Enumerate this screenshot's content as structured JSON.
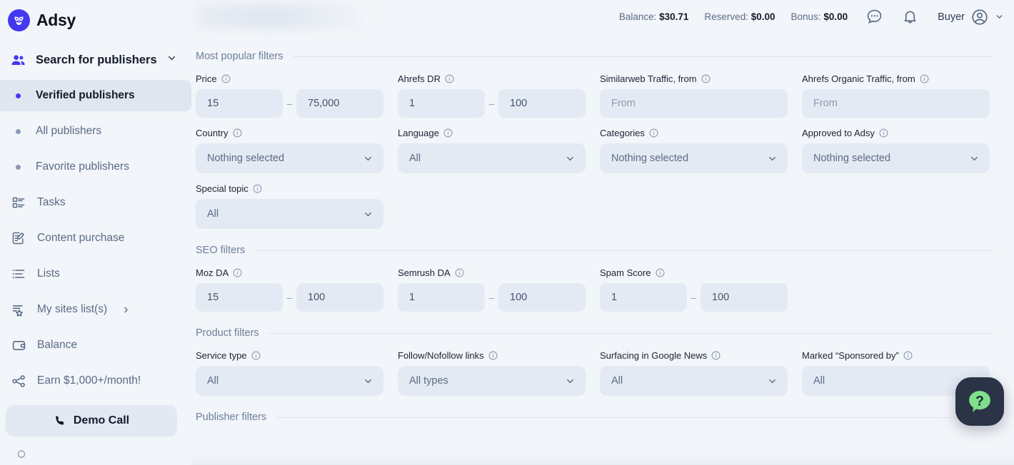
{
  "brand": {
    "name": "Adsy",
    "logo_icon": "owl-icon"
  },
  "sidebar": {
    "search_publishers": {
      "label": "Search for publishers",
      "icon": "users-icon",
      "chevron": "chevron-down-icon"
    },
    "items": [
      {
        "label": "Verified publishers",
        "icon": "dot-icon",
        "active": true
      },
      {
        "label": "All publishers",
        "icon": "dot-icon",
        "active": false
      },
      {
        "label": "Favorite publishers",
        "icon": "dot-icon",
        "active": false
      },
      {
        "label": "Tasks",
        "icon": "tasks-icon",
        "active": false
      },
      {
        "label": "Content purchase",
        "icon": "document-edit-icon",
        "active": false
      },
      {
        "label": "Lists",
        "icon": "list-icon",
        "active": false
      },
      {
        "label": "My sites list(s)",
        "icon": "list-star-icon",
        "active": false,
        "chevron": "chevron-right-icon"
      },
      {
        "label": "Balance",
        "icon": "wallet-icon",
        "active": false
      },
      {
        "label": "Earn $1,000+/month!",
        "icon": "share-icon",
        "active": false
      }
    ],
    "demo_call": {
      "label": "Demo Call",
      "icon": "phone-icon"
    }
  },
  "header": {
    "balance_label": "Balance:",
    "balance_value": "$30.71",
    "reserved_label": "Reserved:",
    "reserved_value": "$0.00",
    "bonus_label": "Bonus:",
    "bonus_value": "$0.00",
    "chat_icon": "chat-icon",
    "bell_icon": "bell-icon",
    "profile_label": "Buyer",
    "profile_icon": "user-circle-icon",
    "profile_chevron": "chevron-down-icon"
  },
  "sections": {
    "popular": "Most popular filters",
    "seo": "SEO filters",
    "product": "Product filters",
    "publisher": "Publisher filters"
  },
  "filters": {
    "price": {
      "label": "Price",
      "from": "15",
      "to": "75,000"
    },
    "ahrefs_dr": {
      "label": "Ahrefs DR",
      "from": "1",
      "to": "100"
    },
    "similarweb": {
      "label": "Similarweb Traffic, from",
      "placeholder": "From",
      "value": ""
    },
    "ahrefs_org": {
      "label": "Ahrefs Organic Traffic, from",
      "placeholder": "From",
      "value": ""
    },
    "country": {
      "label": "Country",
      "value": "Nothing selected"
    },
    "language": {
      "label": "Language",
      "value": "All"
    },
    "categories": {
      "label": "Categories",
      "value": "Nothing selected"
    },
    "approved": {
      "label": "Approved to Adsy",
      "value": "Nothing selected"
    },
    "special_topic": {
      "label": "Special topic",
      "value": "All"
    },
    "moz_da": {
      "label": "Moz DA",
      "from": "15",
      "to": "100"
    },
    "semrush_da": {
      "label": "Semrush DA",
      "from": "1",
      "to": "100"
    },
    "spam_score": {
      "label": "Spam Score",
      "from": "1",
      "to": "100"
    },
    "service_type": {
      "label": "Service type",
      "value": "All"
    },
    "follow_links": {
      "label": "Follow/Nofollow links",
      "value": "All types"
    },
    "google_news": {
      "label": "Surfacing in Google News",
      "value": "All"
    },
    "sponsored": {
      "label": "Marked “Sponsored by”",
      "value": "All"
    }
  },
  "help_widget": {
    "icon": "question-bubble-icon",
    "bg_color": "#2b3347",
    "bubble_color": "#7ee08a"
  },
  "colors": {
    "accent": "#4338f0",
    "field_bg": "#e4eaf3",
    "page_bg": "#f2f5f9",
    "text": "#151b2b",
    "muted": "#5b6b85"
  }
}
